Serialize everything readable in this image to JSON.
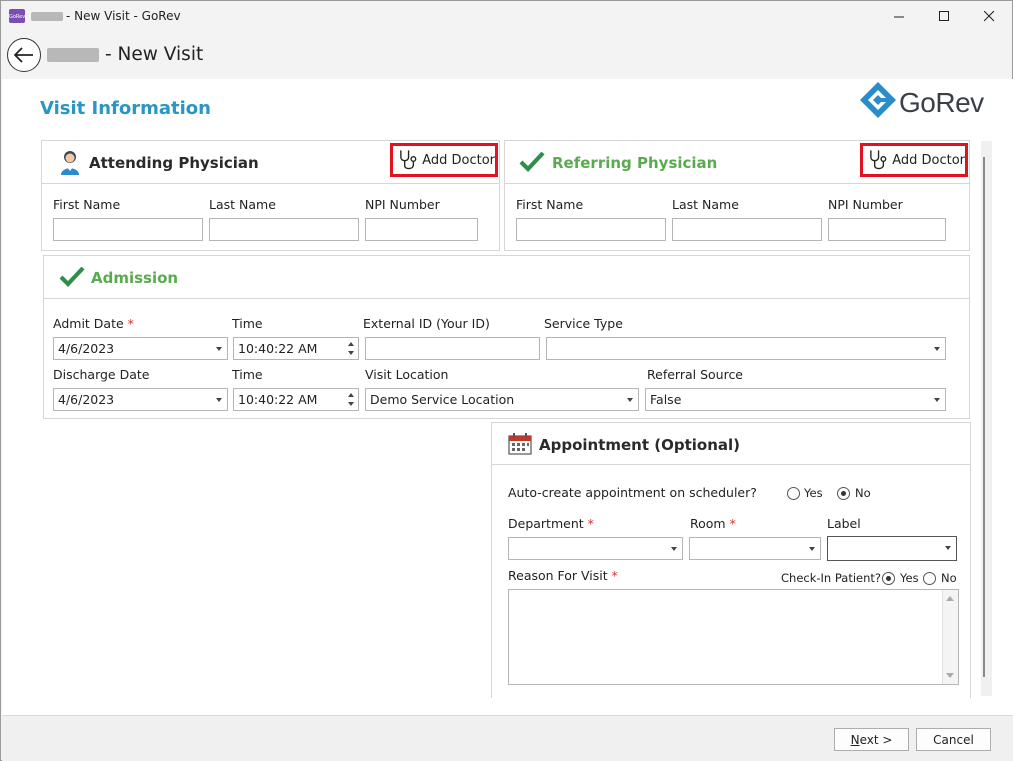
{
  "window": {
    "title": "- New Visit - GoRev",
    "app_icon_text": "GoRev"
  },
  "header": {
    "title": "- New Visit"
  },
  "page": {
    "section_title": "Visit Information",
    "logo_text": "GoRev"
  },
  "attending": {
    "title": "Attending Physician",
    "add_doctor": "Add Doctor",
    "first_name_label": "First Name",
    "last_name_label": "Last Name",
    "npi_label": "NPI Number",
    "first_name": "",
    "last_name": "",
    "npi": ""
  },
  "referring": {
    "title": "Referring Physician",
    "add_doctor": "Add Doctor",
    "first_name_label": "First Name",
    "last_name_label": "Last Name",
    "npi_label": "NPI Number",
    "first_name": "",
    "last_name": "",
    "npi": ""
  },
  "admission": {
    "title": "Admission",
    "admit_date_label": "Admit Date",
    "admit_date": "4/6/2023",
    "time_label": "Time",
    "admit_time": "10:40:22 AM",
    "external_id_label": "External ID (Your ID)",
    "external_id": "",
    "service_type_label": "Service Type",
    "service_type": "",
    "discharge_date_label": "Discharge Date",
    "discharge_date": "4/6/2023",
    "discharge_time_label": "Time",
    "discharge_time": "10:40:22 AM",
    "visit_location_label": "Visit Location",
    "visit_location": "Demo Service Location",
    "referral_source_label": "Referral Source",
    "referral_source": "False",
    "required_mark": "*"
  },
  "appointment": {
    "title": "Appointment (Optional)",
    "auto_create_label": "Auto-create appointment on scheduler?",
    "auto_yes": "Yes",
    "auto_no": "No",
    "auto_selected": "No",
    "department_label": "Department",
    "department": "",
    "room_label": "Room",
    "room": "",
    "label_label": "Label",
    "label_value": "",
    "reason_label": "Reason For Visit",
    "reason": "",
    "checkin_label": "Check-In Patient?",
    "checkin_yes": "Yes",
    "checkin_no": "No",
    "checkin_selected": "Yes",
    "required_mark": "*"
  },
  "footer": {
    "next_label": "ext >",
    "next_mnemonic": "N",
    "cancel_label": "Cancel"
  },
  "colors": {
    "accent_blue": "#2a96c4",
    "success_green": "#5aab4f",
    "highlight_red": "#e0141e"
  }
}
